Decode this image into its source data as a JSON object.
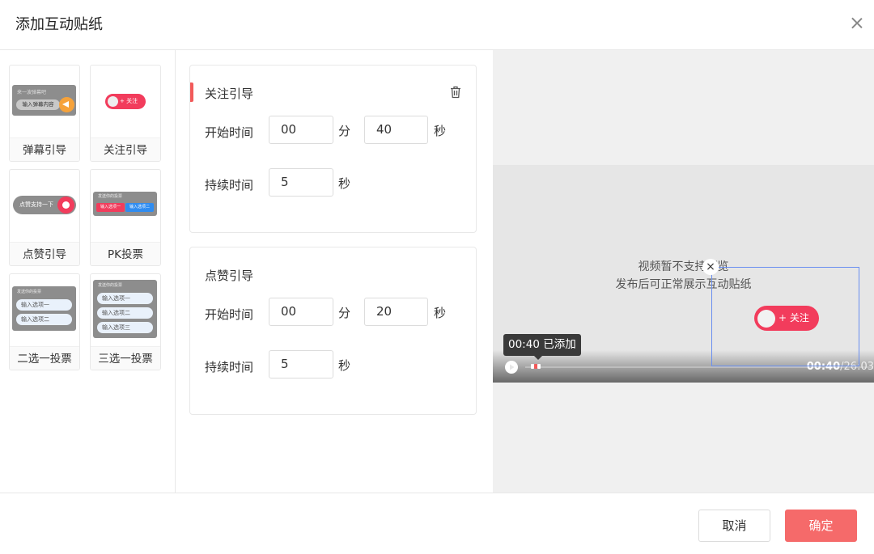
{
  "dialog": {
    "title": "添加互动贴纸"
  },
  "palette": {
    "items": [
      {
        "label": "弹幕引导",
        "thumb_text": "输入弹幕内容",
        "thumb_hint": "来一波弹幕吧"
      },
      {
        "label": "关注引导",
        "thumb_text": "+ 关注"
      },
      {
        "label": "点赞引导",
        "thumb_text": "点赞支持一下"
      },
      {
        "label": "PK投票",
        "thumb_hint": "发送你的投票",
        "opt_a": "输入选项一",
        "opt_b": "输入选项二"
      },
      {
        "label": "二选一投票",
        "thumb_hint": "发送你的投票",
        "opt_a": "输入选项一",
        "opt_b": "输入选项二"
      },
      {
        "label": "三选一投票",
        "thumb_hint": "发送你的投票",
        "opt_a": "输入选项一",
        "opt_b": "输入选项二",
        "opt_c": "输入选项三"
      }
    ]
  },
  "cards": [
    {
      "title": "关注引导",
      "start_label": "开始时间",
      "start_min": "00",
      "min_unit": "分",
      "start_sec": "40",
      "sec_unit": "秒",
      "duration_label": "持续时间",
      "duration": "5",
      "duration_unit": "秒"
    },
    {
      "title": "点赞引导",
      "start_label": "开始时间",
      "start_min": "00",
      "min_unit": "分",
      "start_sec": "20",
      "sec_unit": "秒",
      "duration_label": "持续时间",
      "duration": "5",
      "duration_unit": "秒"
    }
  ],
  "preview": {
    "msg_line1": "视频暂不支持预览",
    "msg_line2": "发布后可正常展示互动贴纸",
    "tooltip": "00:40 已添加",
    "current_time": "00:40",
    "total_time": "/26:03",
    "follow_label": "+ 关注",
    "close_glyph": "×"
  },
  "footer": {
    "cancel": "取消",
    "confirm": "确定"
  },
  "colors": {
    "accent": "#f25a5a",
    "follow": "#f23c5c",
    "confirm": "#f56a6a",
    "selection": "#6a8ff0"
  }
}
